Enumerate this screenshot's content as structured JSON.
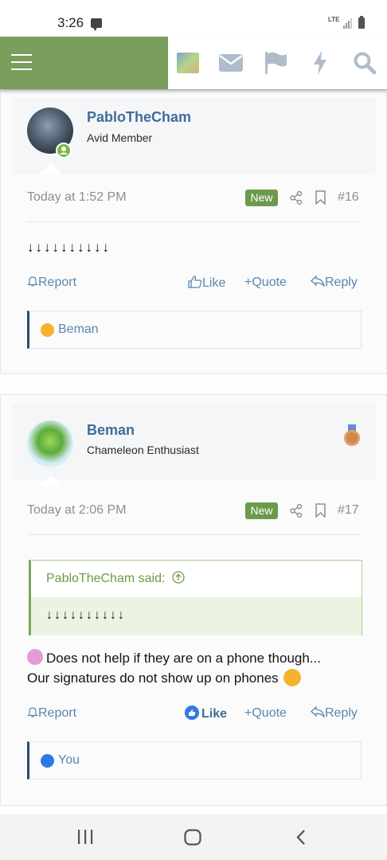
{
  "status": {
    "time": "3:26",
    "network": "LTE"
  },
  "header": {
    "icons": [
      "menu-icon",
      "avatar",
      "envelope-icon",
      "flag-icon",
      "bolt-icon",
      "search-icon"
    ]
  },
  "posts": [
    {
      "username": "PabloTheCham",
      "user_title": "Avid Member",
      "date": "Today at 1:52 PM",
      "badge": "New",
      "number": "#16",
      "body": "↓↓↓↓↓↓↓↓↓↓",
      "actions": {
        "report": "Report",
        "like": "Like",
        "quote": "Quote",
        "reply": "Reply"
      },
      "reactions": "Beman"
    },
    {
      "username": "Beman",
      "user_title": "Chameleon Enthusiast",
      "date": "Today at 2:06 PM",
      "badge": "New",
      "number": "#17",
      "quote": {
        "attribution": "PabloTheCham said:",
        "text": "↓↓↓↓↓↓↓↓↓↓"
      },
      "body_line1": "Does not help if they are on a phone though...",
      "body_line2": "Our signatures do not show up on phones",
      "actions": {
        "report": "Report",
        "like": "Like",
        "quote": "Quote",
        "reply": "Reply"
      },
      "reactions": "You"
    }
  ],
  "colors": {
    "accent_green": "#7a9e5b",
    "link_blue": "#5d85ad",
    "username_blue": "#3d6e9a",
    "badge_green": "#6b9a4c"
  }
}
